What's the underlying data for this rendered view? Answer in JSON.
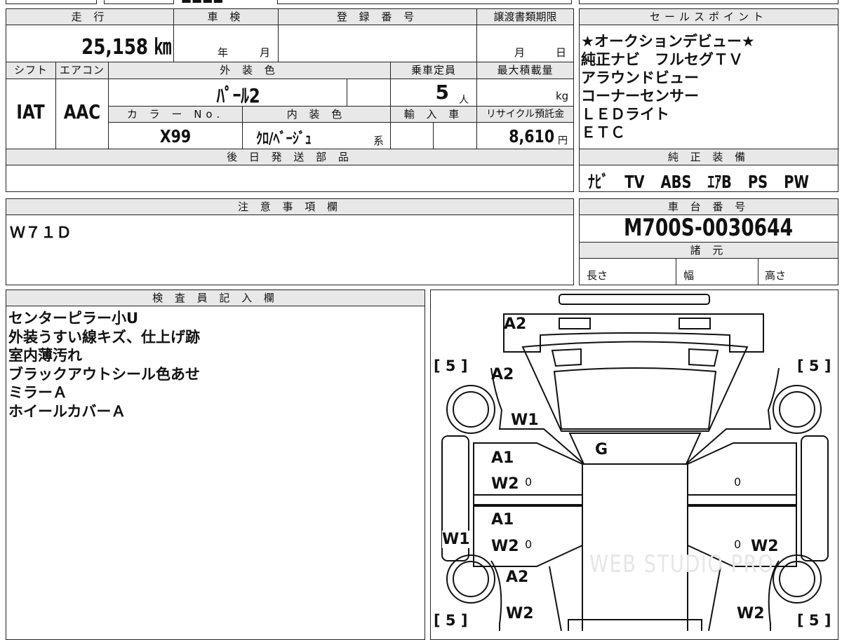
{
  "top_strip": {
    "partial_text": "■■■■"
  },
  "main_table": {
    "mileage_header": "走 行",
    "mileage_value": "25,158 ㎞",
    "shaken_header": "車 検",
    "shaken_year": "年",
    "shaken_month": "月",
    "reg_header": "登 録 番 号",
    "transfer_header": "譲渡書類期限",
    "transfer_month": "月",
    "transfer_day": "日",
    "shift_header": "シフト",
    "aircon_header": "エアコン",
    "exterior_header": "外 装 色",
    "capacity_header": "乗車定員",
    "maxload_header": "最大積載量",
    "shift_value": "IAT",
    "aircon_value": "AAC",
    "exterior_value": "ﾊﾟｰﾙ2",
    "capacity_value": "5",
    "capacity_unit": "人",
    "maxload_unit": "kg",
    "color_no_header": "カ ラ ー No.",
    "interior_header": "内 装 色",
    "import_header": "輸 入 車",
    "recycle_header": "リサイクル預託金",
    "color_no_value": "X99",
    "interior_value": "ｸﾛ/ﾍﾞｰｼﾞｭ",
    "interior_suffix": "系",
    "recycle_value": "8,610",
    "recycle_unit": "円",
    "later_parts_header": "後 日 発 送 部 品"
  },
  "sales_points": {
    "header": "セールスポイント",
    "items": [
      "★オークションデビュー★",
      "純正ナビ　フルセグＴＶ",
      "アラウンドビュー",
      "コーナーセンサー",
      "ＬＥＤライト",
      "ＥＴＣ"
    ]
  },
  "factory_equipment": {
    "header": "純 正 装 備",
    "items": [
      "ﾅﾋﾞ",
      "TV",
      "ABS",
      "ｴｱB",
      "PS",
      "PW"
    ]
  },
  "notes": {
    "header": "注 意 事 項 欄",
    "value": "Ｗ７１Ｄ"
  },
  "chassis": {
    "header": "車 台 番 号",
    "value": "M700S-0030644",
    "specs_header": "諸 元",
    "length_label": "長さ",
    "width_label": "幅",
    "height_label": "高さ"
  },
  "inspector": {
    "header": "検 査 員 記 入 欄",
    "lines": [
      "センターピラー小U",
      "外装うすい線キズ、仕上げ跡",
      "室内薄汚れ",
      "ブラックアウトシール色あせ",
      "ミラーＡ",
      "ホイールカバーＡ"
    ]
  },
  "diagram": {
    "labels": {
      "a2_rear": "A2",
      "a2_left_rear": "A2",
      "w1_left_upper": "W1",
      "g_roof": "G",
      "a1_left_rear_door": "A1",
      "w2_left_rear_door": "W2",
      "a1_left_front_door": "A1",
      "w2_left_front_door": "W2",
      "w1_left_sill": "W1",
      "a2_left_front": "A2",
      "w2_left_front": "W2",
      "w2_right_front_door": "W2",
      "w2_right_front": "W2",
      "zero_1": "0",
      "zero_2": "0",
      "zero_3": "0",
      "zero_4": "0",
      "tire_rl": "[ 5 ]",
      "tire_rr": "[ 5 ]",
      "tire_fl": "[ 5 ]",
      "tire_fr": "[ 5 ]"
    },
    "watermark": "WEB STUDIO PRO"
  }
}
